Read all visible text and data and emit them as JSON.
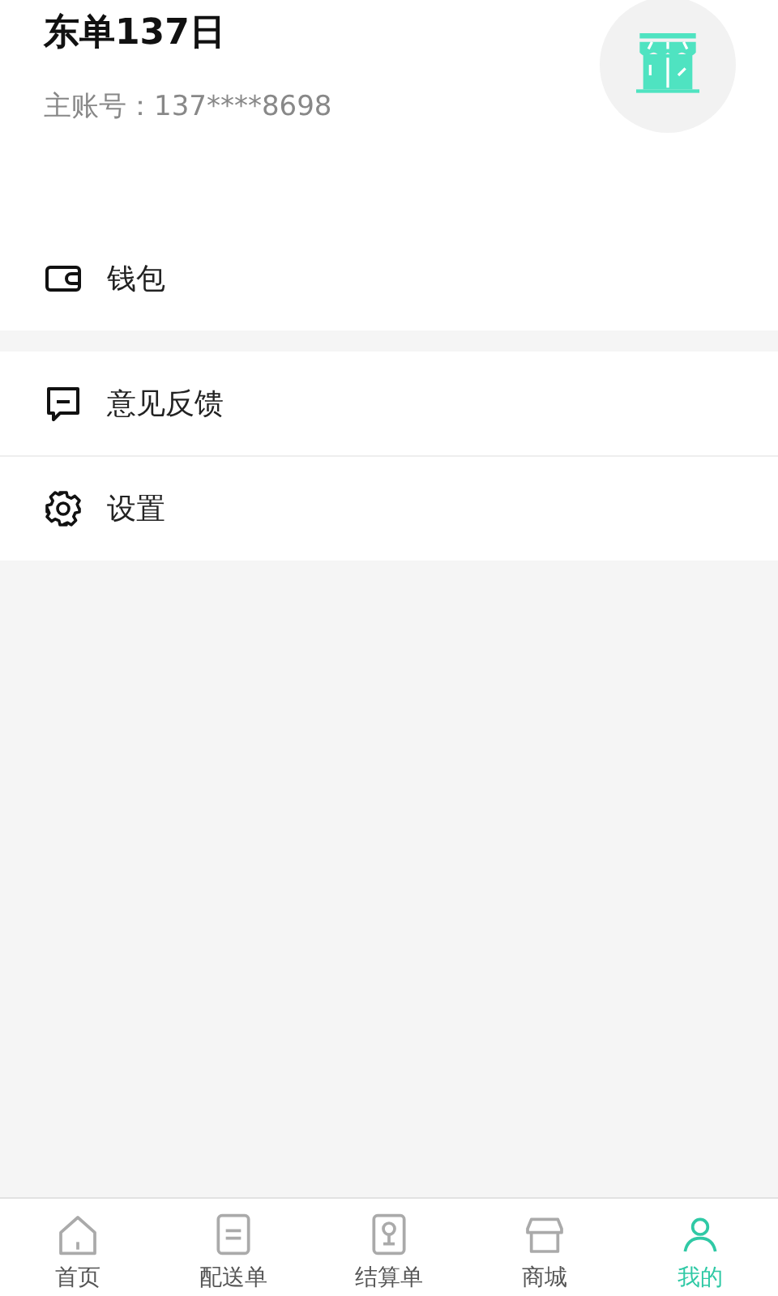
{
  "profile": {
    "name": "东单137日",
    "account": "主账号：137****8698"
  },
  "menu_groups": [
    [
      {
        "kind": "wallet",
        "label": "钱包"
      }
    ],
    [
      {
        "kind": "feedback",
        "label": "意见反馈"
      },
      {
        "kind": "settings",
        "label": "设置"
      }
    ]
  ],
  "tab_bar": [
    {
      "kind": "home",
      "label": "首页",
      "selected": false
    },
    {
      "kind": "list",
      "label": "配送单",
      "selected": false
    },
    {
      "kind": "bill",
      "label": "结算单",
      "selected": false
    },
    {
      "kind": "shop",
      "label": "商城",
      "selected": false
    },
    {
      "kind": "person",
      "label": "我的",
      "selected": true
    }
  ]
}
